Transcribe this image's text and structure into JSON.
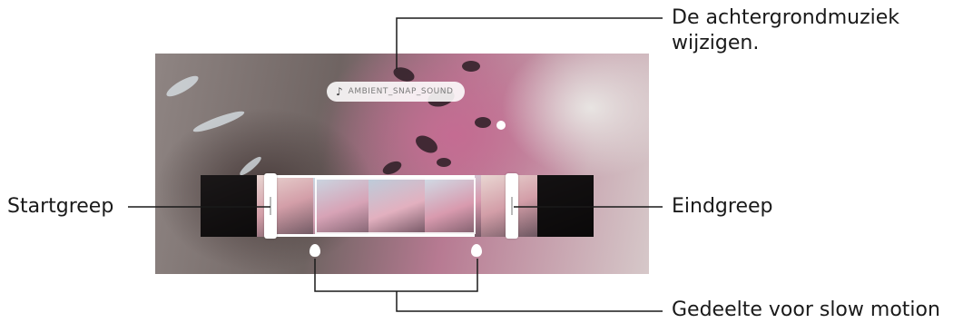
{
  "callouts": {
    "background_music": [
      "De achtergrondmuziek",
      "wijzigen."
    ],
    "start_handle": "Startgreep",
    "end_handle": "Eindgreep",
    "slow_motion_section": "Gedeelte voor slow motion"
  },
  "editor": {
    "music_track_title": "AMBIENT_SNAP_SOUND"
  },
  "colors": {
    "line": "#1a1a1a",
    "handle": "#ffffff"
  }
}
